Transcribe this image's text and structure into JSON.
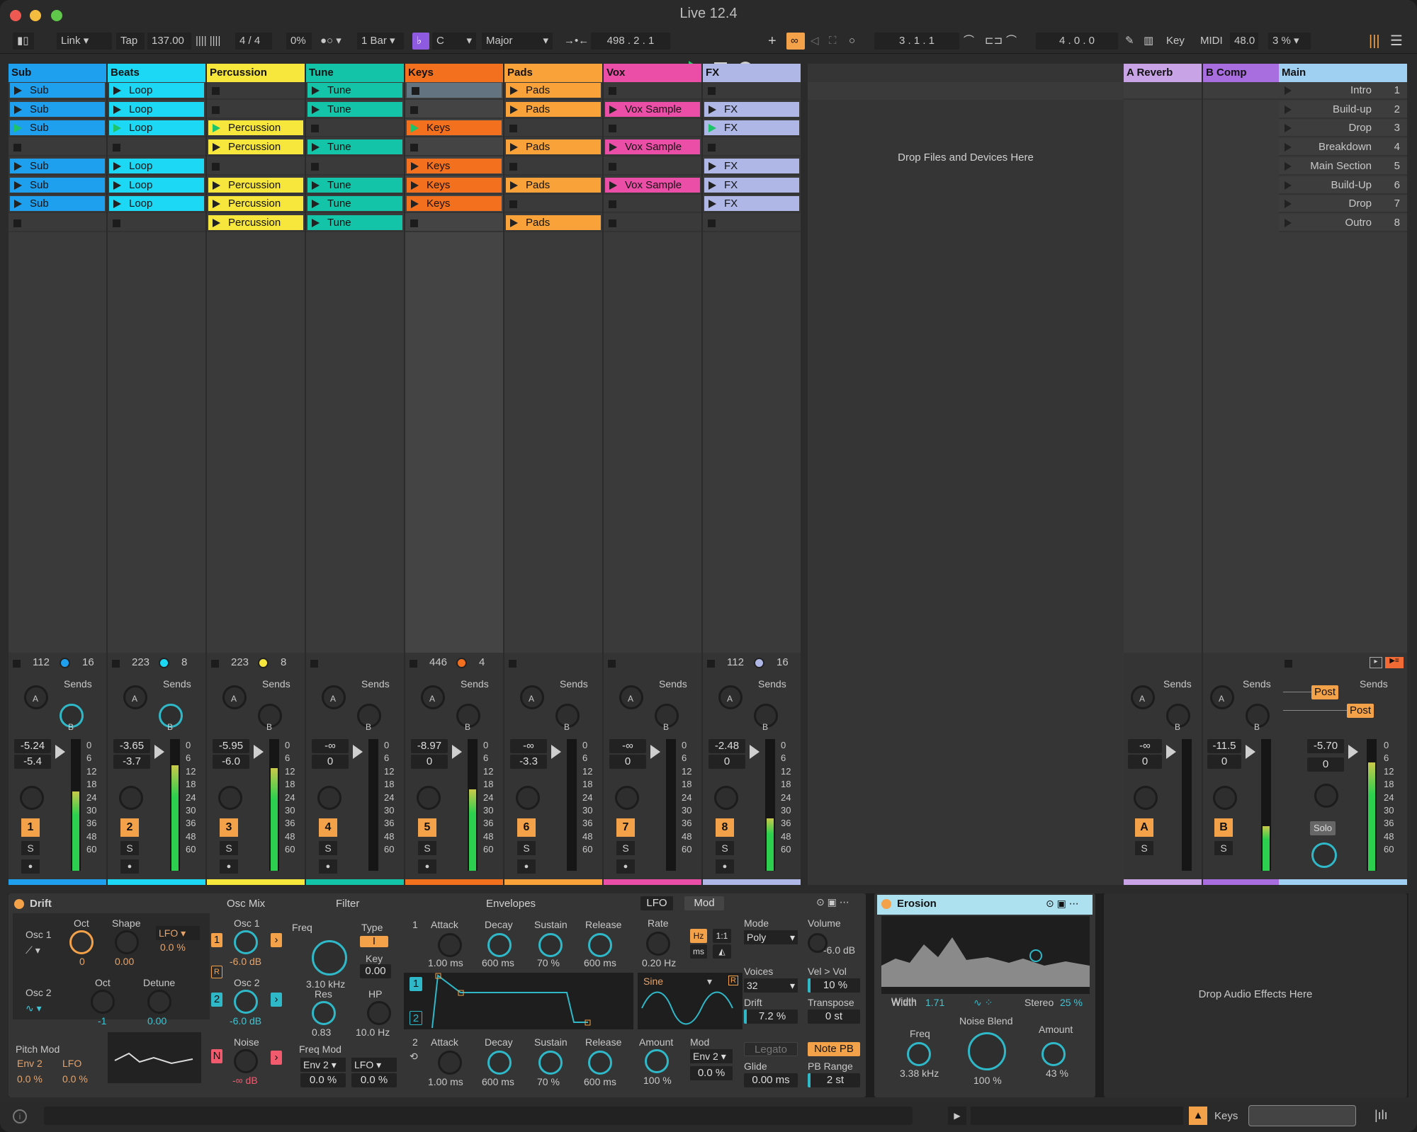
{
  "window": {
    "title": "Live 12.4"
  },
  "control_bar": {
    "link": "Link",
    "tap": "Tap",
    "tempo": "137.00",
    "sig_num": "4",
    "sig_den": "4",
    "swing": "0%",
    "quant": "1 Bar",
    "key": "C",
    "scale": "Major",
    "position": "498 .   2 .   1",
    "loop_start": "3 .   1 .   1",
    "loop_len": "4 .   0 .   0",
    "key_btn": "Key",
    "midi_btn": "MIDI",
    "cpu": "48.0",
    "cpu_pct": "3 %"
  },
  "tracks": [
    {
      "name": "Sub",
      "color": "#1fa0ee",
      "clips": [
        "Sub|stop",
        "Sub",
        "Sub|playing",
        "",
        "Sub",
        "Sub",
        "Sub",
        ""
      ],
      "stops": [
        true,
        false,
        false,
        true,
        false,
        false,
        false,
        true
      ],
      "mono": "112",
      "poly": "16",
      "dot": "#1fa0ee",
      "volume": "-5.24",
      "vol2": "-5.4",
      "num": "1",
      "meter": 0.6
    },
    {
      "name": "Beats",
      "color": "#1dd8f4",
      "clips": [
        "Loop",
        "Loop",
        "Loop|playing",
        "",
        "Loop",
        "Loop",
        "Loop",
        ""
      ],
      "stops": [
        false,
        false,
        false,
        true,
        false,
        false,
        false,
        true
      ],
      "mono": "223",
      "poly": "8",
      "dot": "#1dd8f4",
      "volume": "-3.65",
      "vol2": "-3.7",
      "num": "2",
      "meter": 0.8
    },
    {
      "name": "Percussion",
      "color": "#f7e63c",
      "clips": [
        "",
        "",
        "Percussion|playing",
        "Percussion",
        "",
        "Percussion",
        "Percussion",
        "Percussion"
      ],
      "stops": [
        true,
        true,
        false,
        false,
        true,
        false,
        false,
        false
      ],
      "mono": "223",
      "poly": "8",
      "dot": "#f7e63c",
      "volume": "-5.95",
      "vol2": "-6.0",
      "num": "3",
      "meter": 0.78
    },
    {
      "name": "Tune",
      "color": "#14c4a8",
      "clips": [
        "Tune",
        "Tune",
        "",
        "Tune",
        "",
        "Tune",
        "Tune",
        "Tune"
      ],
      "stops": [
        false,
        false,
        true,
        false,
        true,
        false,
        false,
        false
      ],
      "mono": "",
      "poly": "",
      "dot": "",
      "volume": "-∞",
      "vol2": "0",
      "num": "4",
      "meter": 0
    },
    {
      "name": "Keys",
      "color": "#f3701f",
      "clips": [
        "|grey",
        "",
        "Keys|playing",
        "",
        "Keys",
        "Keys",
        "Keys",
        ""
      ],
      "stops": [
        false,
        true,
        false,
        true,
        false,
        false,
        false,
        true
      ],
      "mono": "446",
      "poly": "4",
      "dot": "#f3701f",
      "volume": "-8.97",
      "vol2": "0",
      "num": "5",
      "meter": 0.62
    },
    {
      "name": "Pads",
      "color": "#f9a23a",
      "clips": [
        "Pads",
        "Pads",
        "",
        "Pads",
        "",
        "Pads",
        "",
        "Pads"
      ],
      "stops": [
        false,
        false,
        true,
        false,
        true,
        false,
        true,
        false
      ],
      "mono": "",
      "poly": "",
      "dot": "",
      "volume": "-∞",
      "vol2": "-3.3",
      "num": "6",
      "meter": 0
    },
    {
      "name": "Vox",
      "color": "#ea4ea6",
      "clips": [
        "",
        "Vox Sample",
        "",
        "Vox Sample",
        "",
        "Vox Sample",
        "",
        ""
      ],
      "stops": [
        true,
        false,
        true,
        false,
        true,
        false,
        true,
        true
      ],
      "mono": "",
      "poly": "",
      "dot": "",
      "volume": "-∞",
      "vol2": "0",
      "num": "7",
      "meter": 0
    },
    {
      "name": "FX",
      "color": "#aeb7e6",
      "clips": [
        "",
        "FX",
        "FX|playing",
        "",
        "FX",
        "FX",
        "FX",
        ""
      ],
      "stops": [
        true,
        false,
        false,
        true,
        false,
        false,
        false,
        true
      ],
      "mono": "112",
      "poly": "16",
      "dot": "#aeb7e6",
      "volume": "-2.48",
      "vol2": "0",
      "num": "8",
      "meter": 0.4
    }
  ],
  "drop_area": "Drop Files and Devices Here",
  "returns": [
    {
      "name": "A Reverb",
      "color": "#c8a4e6",
      "volume": "-∞",
      "vol2": "0",
      "num": "A"
    },
    {
      "name": "B Comp",
      "color": "#a86ee0",
      "volume": "-11.5",
      "vol2": "0",
      "num": "B"
    }
  ],
  "main": {
    "name": "Main",
    "volume": "-5.70",
    "vol2": "0",
    "solo": "Solo",
    "post1": "Post",
    "post2": "Post",
    "scenes": [
      {
        "n": "Intro",
        "i": "1"
      },
      {
        "n": "Build-up",
        "i": "2"
      },
      {
        "n": "Drop",
        "i": "3"
      },
      {
        "n": "Breakdown",
        "i": "4"
      },
      {
        "n": "Main Section",
        "i": "5"
      },
      {
        "n": "Build-Up",
        "i": "6"
      },
      {
        "n": "Drop",
        "i": "7"
      },
      {
        "n": "Outro",
        "i": "8"
      }
    ]
  },
  "sends_label": "Sends",
  "meter_scale": [
    "0",
    "6",
    "12",
    "18",
    "24",
    "30",
    "36",
    "48",
    "60"
  ],
  "drift": {
    "title": "Drift",
    "osc1": "Osc 1",
    "oct": "Oct",
    "shape": "Shape",
    "lfo": "LFO",
    "lfo_val": "0.0 %",
    "oct_val": "0",
    "shape_val": "0.00",
    "osc2": "Osc 2",
    "oct2": "Oct",
    "detune": "Detune",
    "oct2_val": "-1",
    "detune_val": "0.00",
    "oscmix": "Osc Mix",
    "mix1": "Osc 1",
    "mix1_val": "-6.0 dB",
    "mix2": "Osc 2",
    "mix2_val": "-6.0 dB",
    "noise": "Noise",
    "noise_val": "-∞ dB",
    "pitchmod": "Pitch Mod",
    "pm_src1": "Env 2",
    "pm_src2": "LFO",
    "pm_v1": "0.0 %",
    "pm_v2": "0.0 %",
    "filter": "Filter",
    "freq": "Freq",
    "freq_val": "3.10 kHz",
    "type": "Type",
    "key": "Key",
    "key_val": "0.00",
    "res": "Res",
    "res_val": "0.83",
    "hp": "HP",
    "hp_val": "10.0 Hz",
    "freqmod": "Freq Mod",
    "fm_src1": "Env 2",
    "fm_src2": "LFO",
    "fm_v1": "0.0 %",
    "fm_v2": "0.0 %",
    "envelopes": "Envelopes",
    "attack": "Attack",
    "decay": "Decay",
    "sustain": "Sustain",
    "release": "Release",
    "a1": "1.00 ms",
    "d1": "600 ms",
    "s1": "70 %",
    "r1": "600 ms",
    "a2": "1.00 ms",
    "d2": "600 ms",
    "s2": "70 %",
    "r2": "600 ms",
    "lfo_tab": "LFO",
    "mod_tab": "Mod",
    "rate": "Rate",
    "rate_val": "0.20 Hz",
    "hz": "Hz",
    "ms": "ms",
    "ratio": "1:1",
    "wave": "Sine",
    "amount": "Amount",
    "amount_val": "100 %",
    "mod": "Mod",
    "mod_src": "Env 2",
    "mod_val": "0.0 %",
    "mode": "Mode",
    "mode_val": "Poly",
    "voices": "Voices",
    "voices_val": "32",
    "drift_lbl": "Drift",
    "drift_val": "7.2 %",
    "legato": "Legato",
    "glide": "Glide",
    "glide_val": "0.00 ms",
    "volume": "Volume",
    "volume_val": "-6.0 dB",
    "velvol": "Vel > Vol",
    "velvol_val": "10 %",
    "transpose": "Transpose",
    "transpose_val": "0 st",
    "notepb": "Note PB",
    "pbrange": "PB Range",
    "pbrange_val": "2 st"
  },
  "erosion": {
    "title": "Erosion",
    "width": "Width",
    "width_val": "1.71",
    "stereo": "Stereo",
    "stereo_val": "25 %",
    "freq": "Freq",
    "freq_val": "3.38 kHz",
    "noiseblend": "Noise Blend",
    "noiseblend_val": "100 %",
    "amount": "Amount",
    "amount_val": "43 %"
  },
  "drop_fx": "Drop Audio Effects Here",
  "status": {
    "track": "Keys"
  }
}
